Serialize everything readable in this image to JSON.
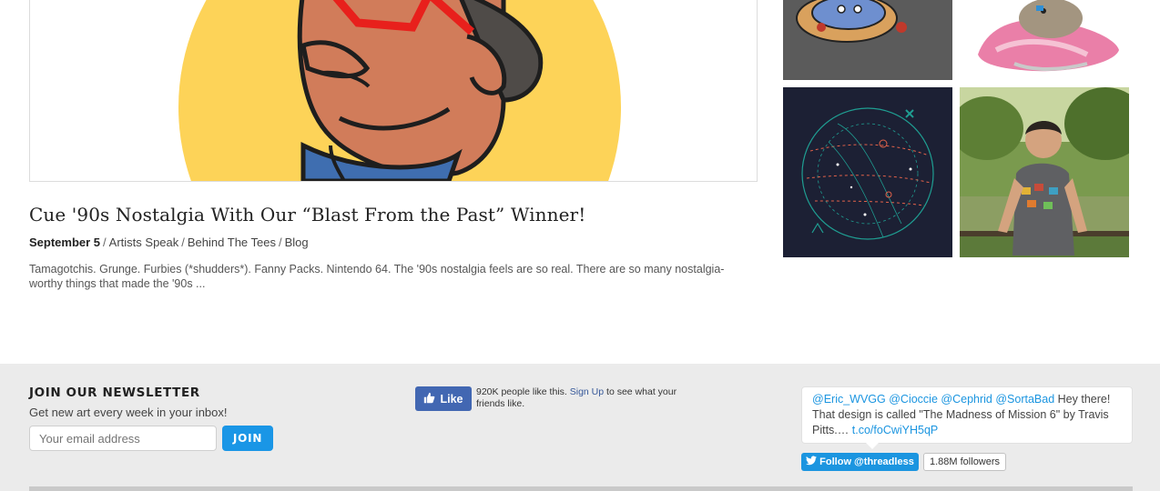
{
  "post": {
    "title": "Cue '90s Nostalgia With Our “Blast From the Past” Winner!",
    "date": "September 5",
    "categories": [
      "Artists Speak",
      "Behind The Tees",
      "Blog"
    ],
    "excerpt": "Tamagotchis. Grunge. Furbies (*shudders*). Fanny Packs. Nintendo 64. The '90s nostalgia feels are so real. There are so many nostalgia-worthy things that made the '90s ..."
  },
  "newsletter": {
    "title": "JOIN OUR NEWSLETTER",
    "subtitle": "Get new art every week in your inbox!",
    "email_placeholder": "Your email address",
    "join_label": "JOIN"
  },
  "facebook": {
    "like_label": "Like",
    "count_text": "920K people like this.",
    "signup_link": "Sign Up",
    "after_text": "to see what your friends like."
  },
  "twitter": {
    "mentions": [
      "@Eric_WVGG",
      "@Cioccie",
      "@Cephrid",
      "@SortaBad"
    ],
    "tweet_text": "Hey there! That design is called \"The Madness of Mission 6\" by Travis Pitts.…",
    "tweet_link": "t.co/foCwiYH5qP",
    "follow_label": "Follow @threadless",
    "followers": "1.88M followers"
  },
  "colors": {
    "join_button": "#1a96e6",
    "facebook_blue": "#4267b2",
    "twitter_blue": "#1b95e0",
    "footer_bg": "#ebebeb"
  },
  "icons": {
    "like": "thumbs-up-icon",
    "follow": "twitter-bird-icon"
  }
}
